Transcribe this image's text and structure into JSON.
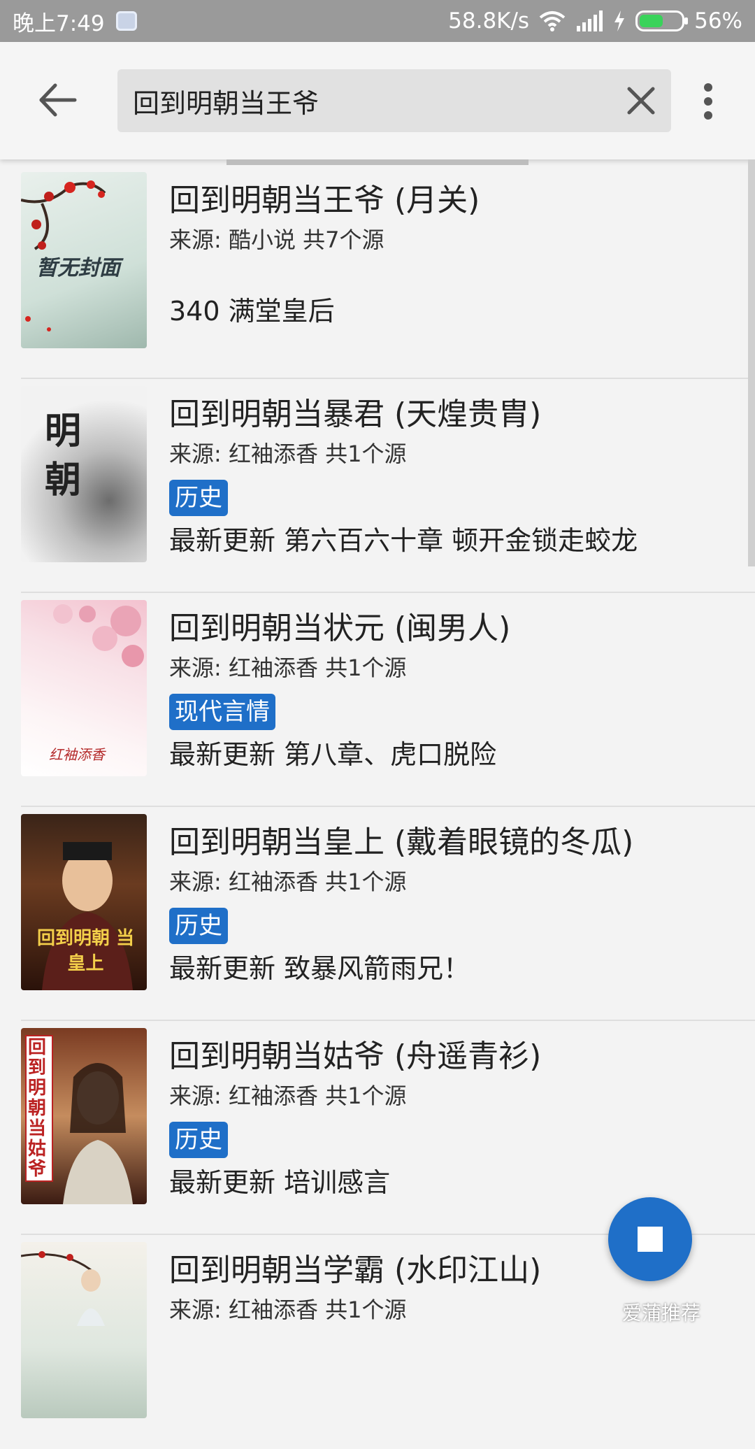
{
  "status_bar": {
    "time": "晚上7:49",
    "net_speed": "58.8K/s",
    "battery": "56%",
    "battery_level": 0.56
  },
  "search": {
    "query": "回到明朝当王爷",
    "back_icon": "arrow-left-icon",
    "clear_icon": "close-icon",
    "more_icon": "more-vertical-icon"
  },
  "colors": {
    "accent": "#1f6fc8",
    "status_bar": "#9a9a9a",
    "background": "#f3f3f3"
  },
  "results": [
    {
      "title": "回到明朝当王爷 (月关)",
      "source": "来源: 酷小说  共7个源",
      "tag": "",
      "latest": "340 满堂皇后",
      "cover_text": "暂无封面"
    },
    {
      "title": "回到明朝当暴君 (天煌贵胄)",
      "source": "来源: 红袖添香  共1个源",
      "tag": "历史",
      "latest": "最新更新 第六百六十章 顿开金锁走蛟龙",
      "cover_text": "明朝"
    },
    {
      "title": "回到明朝当状元 (闽男人)",
      "source": "来源: 红袖添香  共1个源",
      "tag": "现代言情",
      "latest": "最新更新 第八章、虎口脱险",
      "cover_text": "红袖添香"
    },
    {
      "title": "回到明朝当皇上 (戴着眼镜的冬瓜)",
      "source": "来源: 红袖添香  共1个源",
      "tag": "历史",
      "latest": "最新更新 致暴风箭雨兄！",
      "cover_text": "回到明朝 当皇上"
    },
    {
      "title": "回到明朝当姑爷 (舟遥青衫)",
      "source": "来源: 红袖添香  共1个源",
      "tag": "历史",
      "latest": "最新更新 培训感言",
      "cover_text": "回到明朝当姑爷"
    },
    {
      "title": "回到明朝当学霸 (水印江山)",
      "source": "来源: 红袖添香  共1个源",
      "tag": "",
      "latest": "",
      "cover_text": ""
    }
  ],
  "fab": {
    "icon": "stop-icon"
  },
  "watermark": "爱蒲推荐"
}
